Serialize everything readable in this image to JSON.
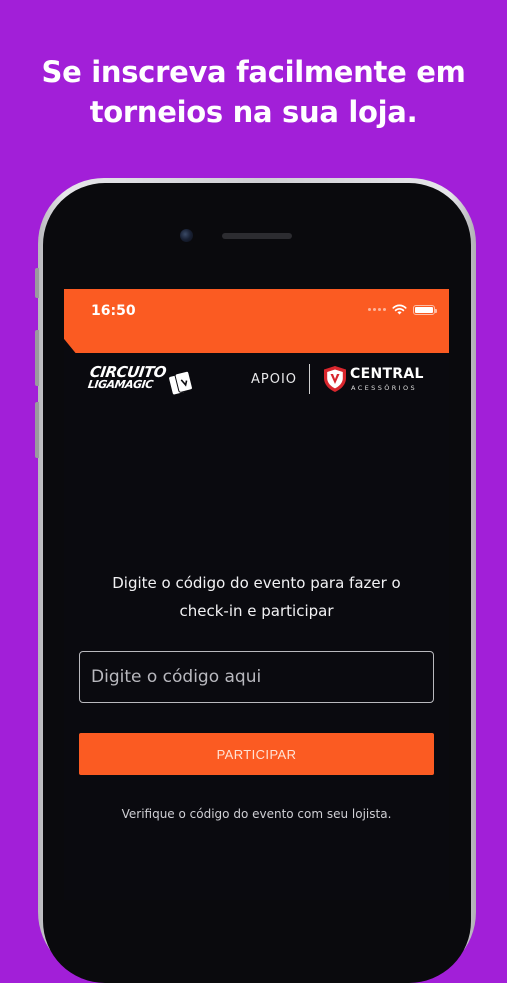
{
  "headline": {
    "line1": "Se inscreva facilmente em",
    "line2": "torneios na sua loja."
  },
  "status_bar": {
    "time": "16:50",
    "battery_level": 1.0
  },
  "header": {
    "logo_line1": "CIRCUITO",
    "logo_line2": "LIGAMAGIC",
    "apoio_label": "APOIO",
    "sponsor_name": "CENTRAL",
    "sponsor_tagline": "ACESSÓRIOS"
  },
  "checkin": {
    "instructions_line1": "Digite o código do evento para fazer o",
    "instructions_line2": "check-in e participar",
    "code_placeholder": "Digite o código aqui",
    "code_value": "",
    "submit_label": "PARTICIPAR",
    "note": "Verifique o código do evento com seu lojista."
  },
  "colors": {
    "background": "#a21fd8",
    "accent": "#fb5b22",
    "screen": "#0a0a0f",
    "sponsor_red": "#d8262d"
  }
}
